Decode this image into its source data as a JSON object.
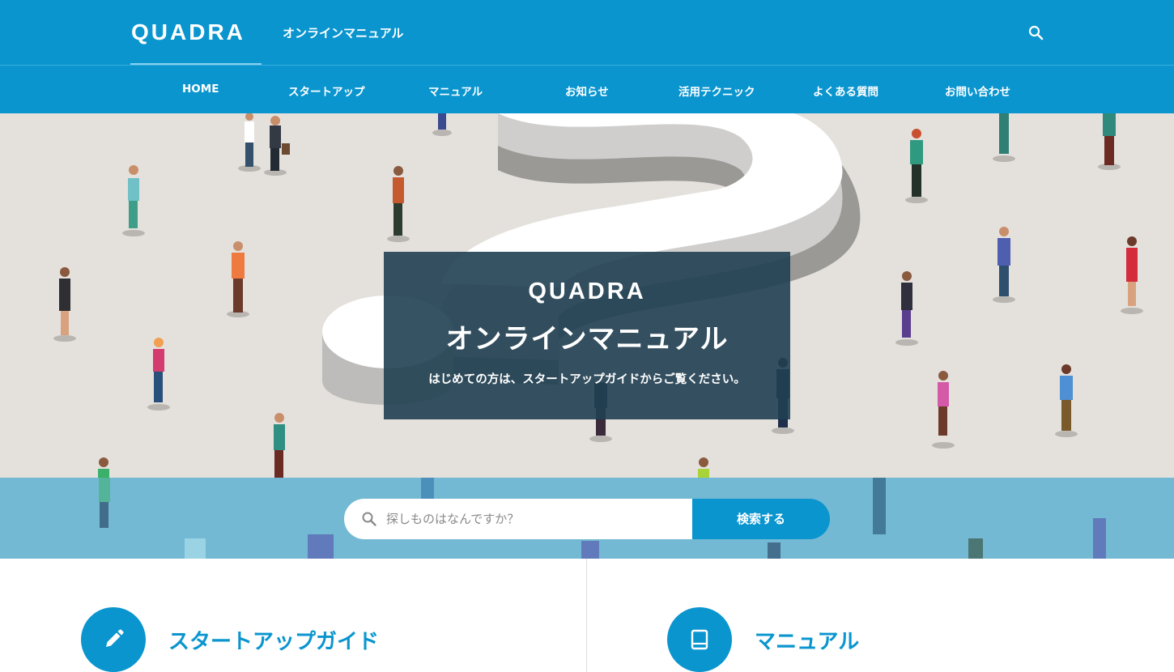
{
  "header": {
    "logo": "QUADRA",
    "subtitle": "オンラインマニュアル"
  },
  "nav": {
    "items": [
      {
        "label": "HOME"
      },
      {
        "label": "スタートアップ"
      },
      {
        "label": "マニュアル"
      },
      {
        "label": "お知らせ"
      },
      {
        "label": "活用テクニック"
      },
      {
        "label": "よくある質問"
      },
      {
        "label": "お問い合わせ"
      }
    ]
  },
  "hero": {
    "logo": "QUADRA",
    "title": "オンラインマニュアル",
    "description": "はじめての方は、スタートアップガイドからご覧ください。"
  },
  "search": {
    "placeholder": "探しものはなんですか？",
    "button_label": "検索する"
  },
  "cards": [
    {
      "label": "スタートアップガイド",
      "icon": "pencil-icon"
    },
    {
      "label": "マニュアル",
      "icon": "book-icon"
    }
  ],
  "colors": {
    "primary": "#0a95cf",
    "hero_bg": "#e4e1dd",
    "strip_bg": "#74b9d3",
    "card_overlay": "#204052"
  }
}
